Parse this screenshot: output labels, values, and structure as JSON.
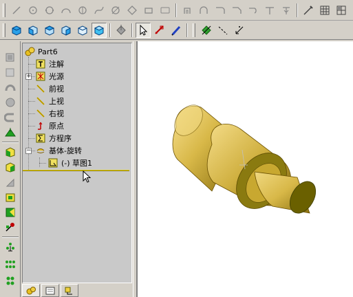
{
  "toolbar_top": {
    "icons": [
      "line-icon",
      "circle-center-icon",
      "circle-three-point-icon",
      "arc-icon",
      "circle-icon",
      "spline-icon",
      "ellipse-icon",
      "polygon-icon",
      "rectangle-icon",
      "rounded-rectangle-icon",
      "offset-icon",
      "trim-icon",
      "fillet-icon",
      "chamfer-icon",
      "extend-icon",
      "mirror-icon",
      "pencil-icon",
      "grid-icon",
      "properties-icon"
    ]
  },
  "toolbar_view": {
    "icons": [
      "isometric-view-icon",
      "front-view-icon",
      "top-view-icon",
      "right-view-icon",
      "back-view-icon",
      "shaded-view-icon",
      "normal-to-icon",
      "select-icon",
      "smart-dimension-icon",
      "sketch-pencil-icon",
      "point-icon",
      "centerline-icon",
      "coordinate-icon"
    ]
  },
  "tree": {
    "root": "Part6",
    "items": [
      {
        "label": "注解",
        "icon": "annotation-icon"
      },
      {
        "label": "光源",
        "icon": "lighting-icon"
      },
      {
        "label": "前视",
        "icon": "plane-icon"
      },
      {
        "label": "上视",
        "icon": "plane-icon"
      },
      {
        "label": "右视",
        "icon": "plane-icon"
      },
      {
        "label": "原点",
        "icon": "origin-icon"
      },
      {
        "label": "方程序",
        "icon": "equation-icon"
      },
      {
        "label": "基体-旋转",
        "icon": "revolve-icon"
      },
      {
        "label": "(-) 草图1",
        "icon": "sketch-icon"
      }
    ],
    "expander_collapsed": "+",
    "expander_expanded": "−"
  },
  "tabs": [
    "feature-manager-tab",
    "property-manager-tab",
    "configuration-manager-tab"
  ],
  "colors": {
    "part_gold": "#d8b848",
    "part_dark": "#8a7010",
    "rollback_bar": "#e6d000",
    "tree_bg": "#c9c9c9"
  }
}
